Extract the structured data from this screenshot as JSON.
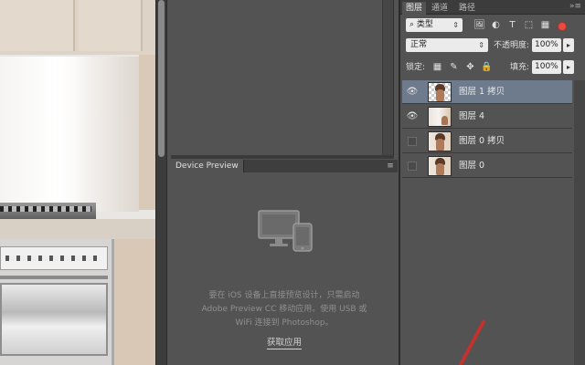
{
  "layers_panel": {
    "tabs": [
      "图层",
      "通道",
      "路径"
    ],
    "menu_glyph": "»≡",
    "filter": {
      "label": "类型",
      "caret": "⇕",
      "search_glyph": "⌕"
    },
    "filter_icons": [
      "🖼",
      "◐",
      "T",
      "⬚",
      "▦"
    ],
    "blend_mode": {
      "label": "正常",
      "caret": "⇕"
    },
    "opacity": {
      "label": "不透明度:",
      "value": "100%",
      "arrow": "▸"
    },
    "lock": {
      "label": "锁定:",
      "icons": [
        "▦",
        "✎",
        "✥",
        "🔒"
      ]
    },
    "fill": {
      "label": "填充:",
      "value": "100%",
      "arrow": "▸"
    },
    "layers": [
      {
        "name": "图层 1 拷贝",
        "visible": true,
        "selected": true,
        "thumb": "transparent"
      },
      {
        "name": "图层 4",
        "visible": true,
        "selected": false,
        "thumb": "photo"
      },
      {
        "name": "图层 0 拷贝",
        "visible": false,
        "selected": false,
        "thumb": "portrait"
      },
      {
        "name": "图层 0",
        "visible": false,
        "selected": false,
        "thumb": "portrait"
      }
    ],
    "eye_glyph": "👁"
  },
  "device_preview": {
    "tab_label": "Device Preview",
    "menu_glyph": "≡",
    "message_lines": [
      "要在 iOS 设备上直接预览设计，只需启动",
      "Adobe Preview CC 移动应用。使用 USB 或",
      "WiFi 连接到 Photoshop。"
    ],
    "link_label": "获取应用"
  },
  "colors": {
    "panel_bg": "#535353",
    "panel_dark": "#3c3c3c",
    "selected_layer": "#6d7b8d",
    "annotation_red": "#c0322d"
  }
}
